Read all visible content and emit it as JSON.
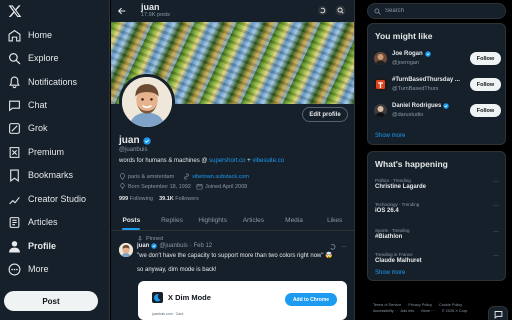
{
  "nav": {
    "items": [
      {
        "label": "Home",
        "icon": "home-icon"
      },
      {
        "label": "Explore",
        "icon": "search-icon"
      },
      {
        "label": "Notifications",
        "icon": "bell-icon"
      },
      {
        "label": "Chat",
        "icon": "chat-icon"
      },
      {
        "label": "Grok",
        "icon": "grok-icon"
      },
      {
        "label": "Premium",
        "icon": "x-premium-icon"
      },
      {
        "label": "Bookmarks",
        "icon": "bookmark-icon"
      },
      {
        "label": "Creator Studio",
        "icon": "creator-icon"
      },
      {
        "label": "Articles",
        "icon": "articles-icon"
      },
      {
        "label": "Profile",
        "icon": "person-icon"
      },
      {
        "label": "More",
        "icon": "more-icon"
      }
    ],
    "post_label": "Post"
  },
  "header": {
    "name": "juan",
    "posts_count": "17.9K posts"
  },
  "profile": {
    "name": "juan",
    "handle": "@juanbuis",
    "edit_label": "Edit profile",
    "bio_prefix": "words for humans & machines @ ",
    "bio_link1": "supershort.co",
    "bio_plus": " + ",
    "bio_link2": "vibesuite.co",
    "location": "paris & amsterdam",
    "website": "vibetown.substack.com",
    "born": "Born September 18, 1992",
    "joined": "Joined April 2008",
    "following_count": "999",
    "following_label": "Following",
    "followers_count": "39.1K",
    "followers_label": "Followers"
  },
  "tabs": [
    "Posts",
    "Replies",
    "Highlights",
    "Articles",
    "Media",
    "Likes"
  ],
  "pinned_tweet": {
    "pinned_label": "Pinned",
    "author": "juan",
    "handle": "@juanbuis",
    "date": "· Feb 12",
    "text1": "\"we don't have the capacity to support more than two colors right now\" 🤯",
    "text2": "so anyway, dim mode is back!",
    "card": {
      "title": "X Dim Mode",
      "button": "Add to Chrome",
      "small": "juanbuis.com   ·   Card"
    }
  },
  "search": {
    "placeholder": "Search"
  },
  "suggestions": {
    "title": "You might like",
    "items": [
      {
        "name": "Joe Rogan",
        "handle": "@joerogan",
        "button": "Follow",
        "avatar_color": "#6b4a3a"
      },
      {
        "name": "#TurnBasedThursday ...",
        "handle": "@TurnBasedThurs",
        "button": "Follow",
        "avatar_color": "#e0441b"
      },
      {
        "name": "Daniel Rodrigues",
        "handle": "@darustudio",
        "button": "Follow",
        "avatar_color": "#3b3b3b"
      }
    ],
    "show_more": "Show more"
  },
  "trending": {
    "title": "What's happening",
    "items": [
      {
        "category": "Politics · Trending",
        "name": "Christine Lagarde"
      },
      {
        "category": "Technology · Trending",
        "name": "iOS 26.4"
      },
      {
        "category": "Sports · Trending",
        "name": "#Biathlon"
      },
      {
        "category": "Trending in France",
        "name": "Claude Malhuret"
      }
    ],
    "show_more": "Show more"
  },
  "footer": {
    "links": [
      "Terms of Service",
      "Privacy Policy",
      "Cookie Policy",
      "Accessibility",
      "Ads info",
      "More ···",
      "© 2026 X Corp."
    ]
  },
  "colors": {
    "accent": "#1d9bf0",
    "dim_bg": "#15202b",
    "border": "#2f3336",
    "muted": "#8b98a5"
  }
}
